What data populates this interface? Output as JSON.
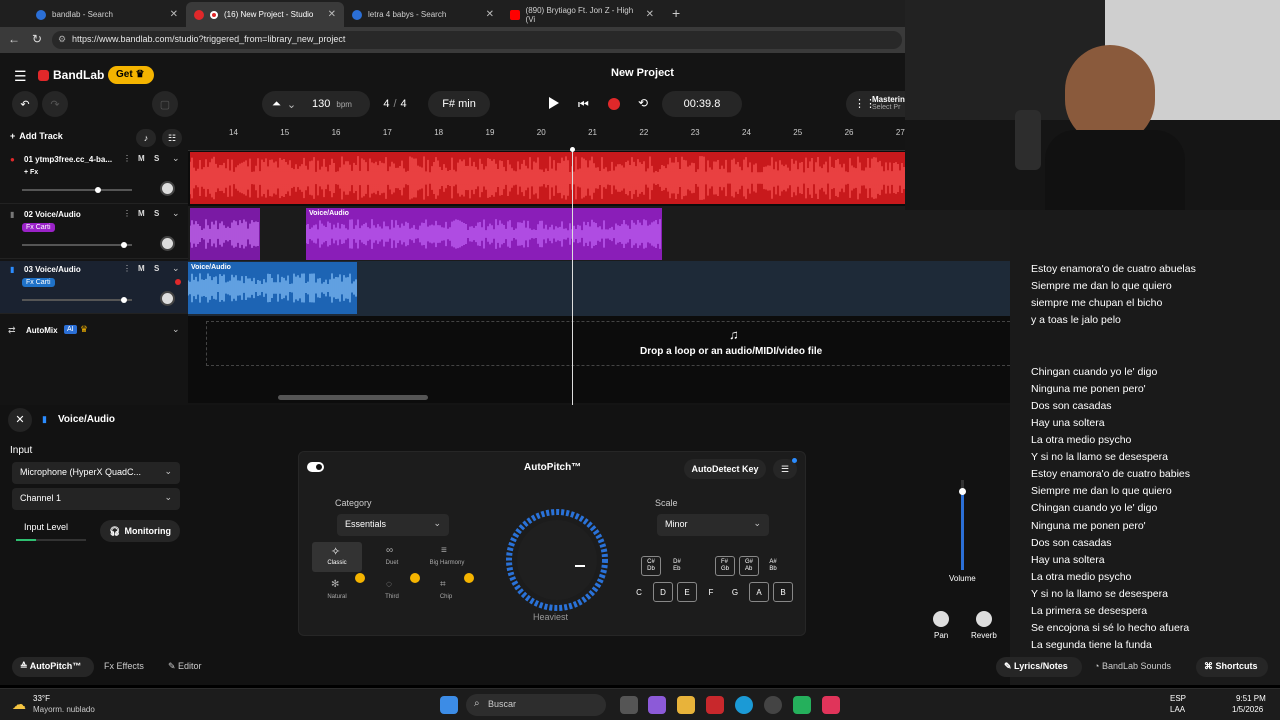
{
  "browser": {
    "tabs": [
      {
        "title": "bandlab - Search",
        "active": false
      },
      {
        "title": "(16) New Project - Studio",
        "active": true
      },
      {
        "title": "letra 4 babys - Search",
        "active": false
      },
      {
        "title": "(890) Brytiago Ft. Jon Z - High (Vi",
        "active": false
      }
    ],
    "new_tab": "+",
    "url": "https://www.bandlab.com/studio?triggered_from=library_new_project"
  },
  "app": {
    "logo": "BandLab",
    "get_label": "Get",
    "project_title": "New Project",
    "bpm_value": "130",
    "bpm_unit": "bpm",
    "time_sig_num": "4",
    "time_sig_sep": "/",
    "time_sig_den": "4",
    "key": "F# min",
    "time": "00:39.8",
    "mastering_label": "Masterin",
    "mastering_sub": "Select Pr",
    "add_track": "Add Track",
    "ruler": [
      "14",
      "15",
      "16",
      "17",
      "18",
      "19",
      "20",
      "21",
      "22",
      "23",
      "24",
      "25",
      "26",
      "27"
    ],
    "tracks": [
      {
        "name": "01  ytmp3free.cc_4-ba...",
        "fx": "+ Fx",
        "volume": 0.69,
        "color": "#e0282a",
        "clips": [
          {
            "label": ""
          }
        ]
      },
      {
        "name": "02  Voice/Audio",
        "fx": "Fx Carti",
        "volume": 0.93,
        "color": "#9a22c8",
        "clips": [
          {
            "label": ""
          },
          {
            "label": "Voice/Audio"
          }
        ]
      },
      {
        "name": "03  Voice/Audio",
        "fx": "Fx Carti",
        "volume": 0.93,
        "color": "#1f72c8",
        "clips": [
          {
            "label": "Voice/Audio"
          }
        ]
      }
    ],
    "m_label": "M",
    "s_label": "S",
    "automix_label": "AutoMix",
    "ai_badge": "AI",
    "drop_text": "Drop a loop or an audio/MIDI/video file"
  },
  "panel": {
    "title": "Voice/Audio",
    "input_label": "Input",
    "mic": "Microphone (HyperX QuadC...",
    "channel": "Channel 1",
    "input_level_label": "Input Level",
    "monitoring": "Monitoring",
    "autopitch_title": "AutoPitch™",
    "autodetect": "AutoDetect Key",
    "category_label": "Category",
    "category_value": "Essentials",
    "modes": [
      "Classic",
      "Duet",
      "Big Harmony",
      "Natural",
      "Third",
      "Chip"
    ],
    "scale_label": "Scale",
    "scale_value": "Minor",
    "heaviest": "Heaviest",
    "sharp_keys": [
      "C#\nDb",
      "D#\nEb",
      "F#\nGb",
      "G#\nAb",
      "A#\nBb"
    ],
    "keys": [
      "C",
      "D",
      "E",
      "F",
      "G",
      "A",
      "B"
    ],
    "volume_label": "Volume",
    "pan_label": "Pan",
    "reverb_label": "Reverb",
    "bottom_tabs": [
      "AutoPitch™",
      "Effects",
      "Editor"
    ],
    "right_tabs": [
      "Lyrics/Notes",
      "BandLab Sounds",
      "Shortcuts"
    ]
  },
  "lyrics": [
    "Estoy enamora'o de cuatro abuelas",
    "Siempre me dan lo que quiero",
    "siempre me chupan el bicho",
    "y a toas le jalo pelo",
    "",
    "",
    "Chingan cuando yo le' digo",
    "Ninguna me ponen pero'",
    "Dos son casadas",
    "Hay una soltera",
    "La otra medio psycho",
    "Y si no la llamo se desespera",
    "Estoy enamora'o de cuatro babies",
    "Siempre me dan lo que quiero",
    "Chingan cuando yo le' digo",
    "Ninguna me ponen pero'",
    "Dos son casadas",
    "Hay una soltera",
    "La otra medio psycho",
    "Y si no la llamo se desespera",
    "La primera se desespera",
    "Se encojona si sé lo hecho afuera",
    "La segunda tiene la funda"
  ],
  "taskbar": {
    "temp": "33°F",
    "weather": "Mayorm. nublado",
    "search": "Buscar",
    "lang1": "ESP",
    "lang2": "LAA",
    "clock": "9:51 PM",
    "date": "1/5/2026"
  }
}
